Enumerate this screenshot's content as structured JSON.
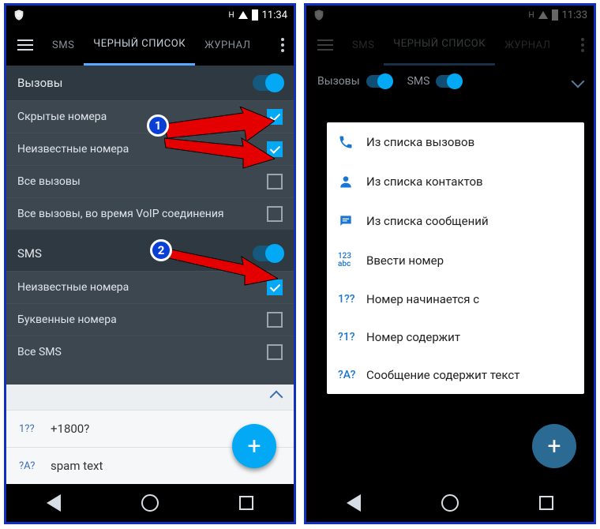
{
  "left": {
    "time": "11:34",
    "tabs": {
      "sms": "SMS",
      "blacklist": "ЧЕРНЫЙ СПИСОК",
      "log": "ЖУРНАЛ"
    },
    "section_calls": "Вызовы",
    "rows_calls": [
      {
        "label": "Скрытые номера",
        "checked": true
      },
      {
        "label": "Неизвестные номера",
        "checked": true
      },
      {
        "label": "Все вызовы",
        "checked": false
      },
      {
        "label": "Все вызовы, во время VoIP соединения",
        "checked": false
      }
    ],
    "section_sms": "SMS",
    "rows_sms": [
      {
        "label": "Неизвестные номера",
        "checked": true
      },
      {
        "label": "Буквенные номера",
        "checked": false
      },
      {
        "label": "Все SMS",
        "checked": false
      }
    ],
    "entries": [
      {
        "icon": "1??",
        "text": "+1800?"
      },
      {
        "icon": "?A?",
        "text": "spam text"
      }
    ],
    "badge1": "1",
    "badge2": "2"
  },
  "right": {
    "time": "11:33",
    "tabs": {
      "sms": "SMS",
      "blacklist": "ЧЕРНЫЙ СПИСОК",
      "log": "ЖУРНАЛ"
    },
    "header": {
      "calls": "Вызовы",
      "sms": "SMS"
    },
    "menu": [
      {
        "kind": "phone",
        "label": "Из списка вызовов"
      },
      {
        "kind": "person",
        "label": "Из списка контактов"
      },
      {
        "kind": "msg",
        "label": "Из списка сообщений"
      },
      {
        "kind": "123",
        "text": "123\nabc",
        "label": "Ввести номер"
      },
      {
        "kind": "txt",
        "text": "1??",
        "label": "Номер начинается с"
      },
      {
        "kind": "txt",
        "text": "?1?",
        "label": "Номер содержит"
      },
      {
        "kind": "txt",
        "text": "?A?",
        "label": "Сообщение содержит текст"
      }
    ]
  }
}
